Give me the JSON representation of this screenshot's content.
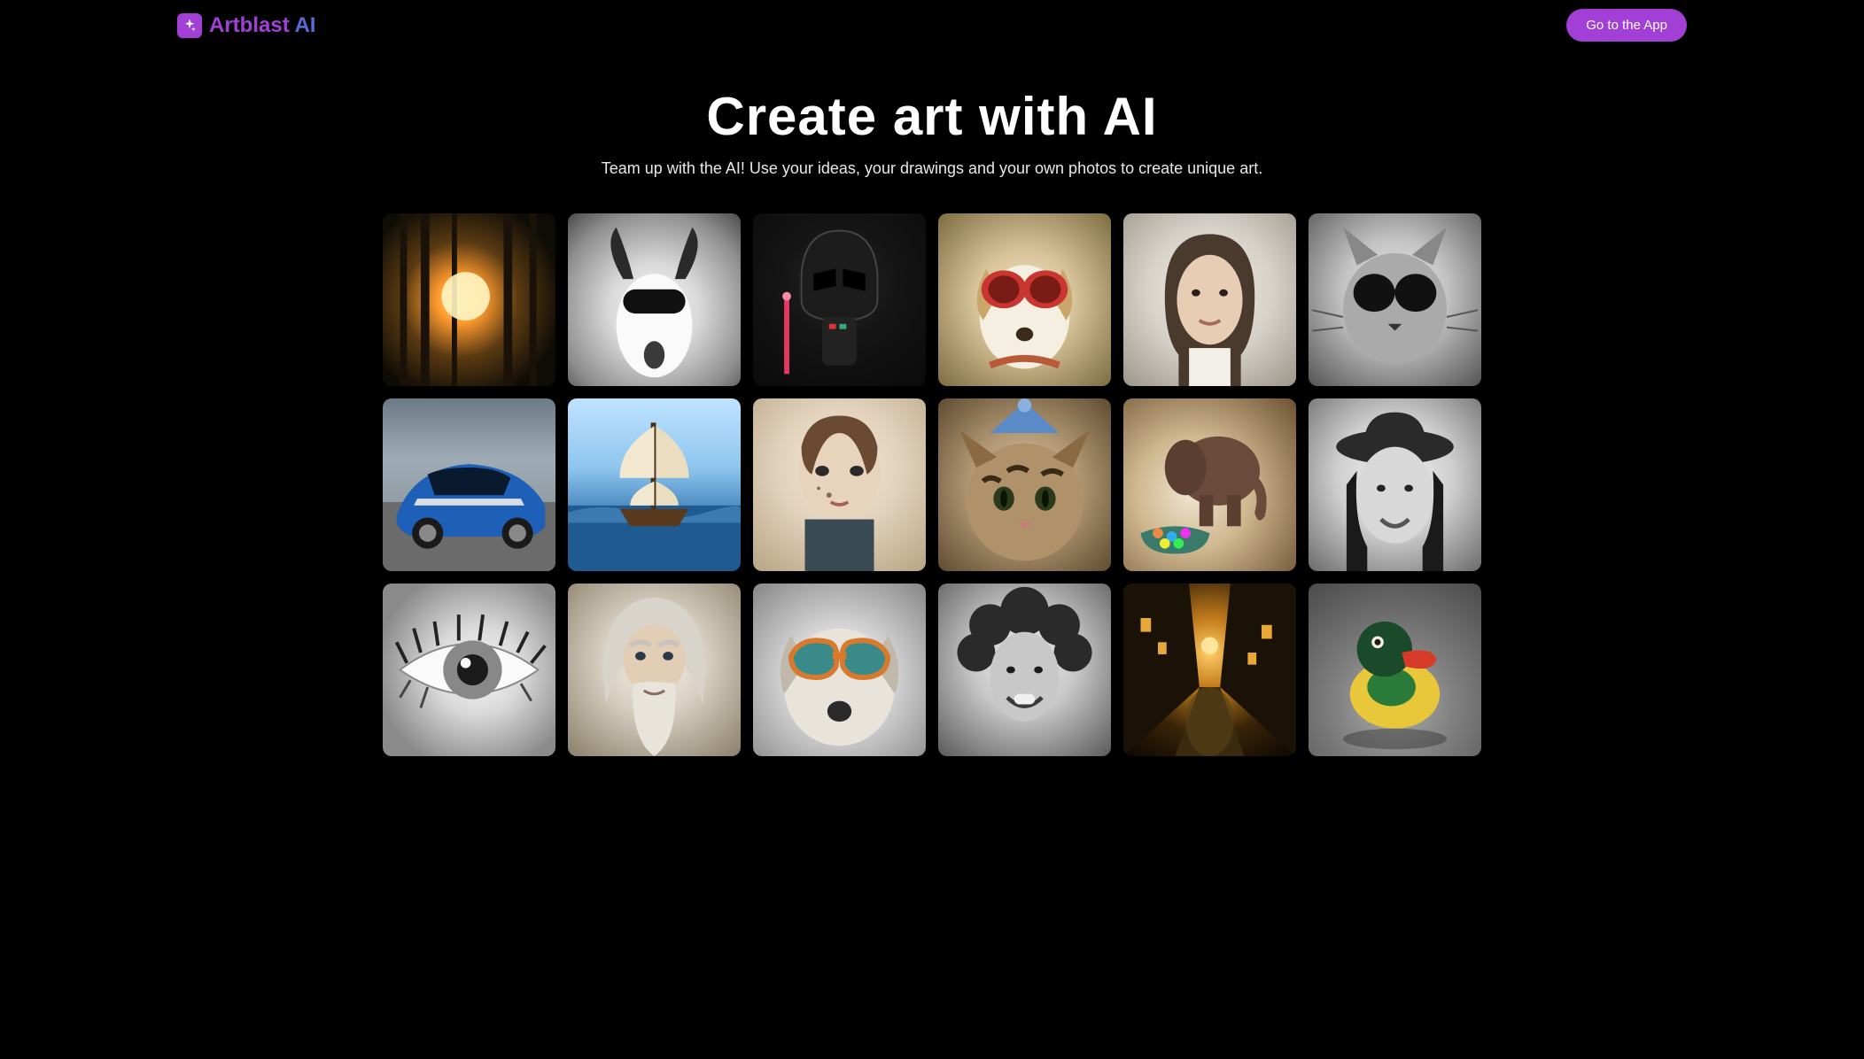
{
  "brand": {
    "name_part1": "Artblast ",
    "name_part2": "AI"
  },
  "header": {
    "cta_label": "Go to the App"
  },
  "hero": {
    "title": "Create art with AI",
    "subtitle": "Team up with the AI! Use your ideas, your drawings and your own photos to create unique art."
  },
  "gallery": {
    "items": [
      {
        "name": "forest-sunlight"
      },
      {
        "name": "goat-sunglasses-bw"
      },
      {
        "name": "darth-vader-chibi"
      },
      {
        "name": "dog-red-sunglasses"
      },
      {
        "name": "woman-portrait"
      },
      {
        "name": "cat-sunglasses-bw"
      },
      {
        "name": "blue-sports-car"
      },
      {
        "name": "sailing-ship-sea"
      },
      {
        "name": "girl-watercolor-portrait"
      },
      {
        "name": "tabby-cat-party-hat"
      },
      {
        "name": "elephant-figurine-candy"
      },
      {
        "name": "woman-fedora-bw"
      },
      {
        "name": "eye-closeup-bw"
      },
      {
        "name": "wizard-old-man"
      },
      {
        "name": "dog-orange-sunglasses"
      },
      {
        "name": "woman-curly-hair-bw"
      },
      {
        "name": "old-town-street-night"
      },
      {
        "name": "colorful-rubber-duck"
      }
    ]
  },
  "colors": {
    "accent_purple": "#a23fd6",
    "accent_blue": "#5b6bd6",
    "bg": "#000000",
    "text": "#ffffff"
  }
}
